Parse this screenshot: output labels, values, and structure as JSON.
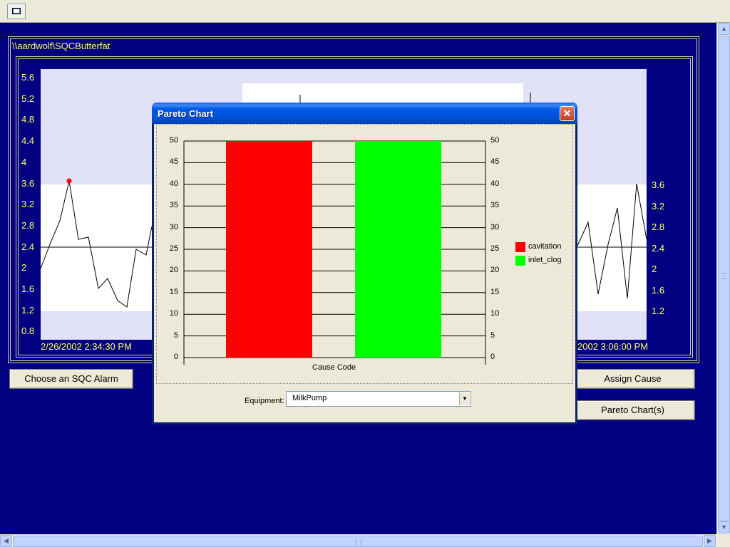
{
  "sqc": {
    "title": "\\\\aardwolf\\SQCButterfat",
    "y_left_ticks": [
      "5.6",
      "5.2",
      "4.8",
      "4.4",
      "4",
      "3.6",
      "3.2",
      "2.8",
      "2.4",
      "2",
      "1.6",
      "1.2",
      "0.8"
    ],
    "y_right_ticks": [
      "3.6",
      "3.2",
      "2.8",
      "2.4",
      "2",
      "1.6",
      "1.2"
    ],
    "x_start_label": "2/26/2002 2:34:30 PM",
    "x_end_label": "2002 3:06:00 PM",
    "centerline": 2.4
  },
  "buttons": {
    "choose_alarm": "Choose an SQC Alarm",
    "assign_cause": "Assign Cause",
    "pareto_charts": "Pareto Chart(s)"
  },
  "dialog": {
    "title": "Pareto Chart",
    "close_icon": "close-icon",
    "equipment_label": "Equipment:",
    "equipment_value": "MilkPump"
  },
  "chart_data": {
    "type": "bar",
    "xlabel": "Cause Code",
    "ylabel": "",
    "ylim": [
      0,
      50
    ],
    "yticks": [
      0,
      5,
      10,
      15,
      20,
      25,
      30,
      35,
      40,
      45,
      50
    ],
    "categories": [
      "cavitation",
      "inlet_clog"
    ],
    "values": [
      50,
      50
    ],
    "colors": [
      "#ff0000",
      "#00ff00"
    ],
    "legend": "right",
    "grid": true
  },
  "colors": {
    "background": "#000080",
    "label": "#ffff66"
  }
}
